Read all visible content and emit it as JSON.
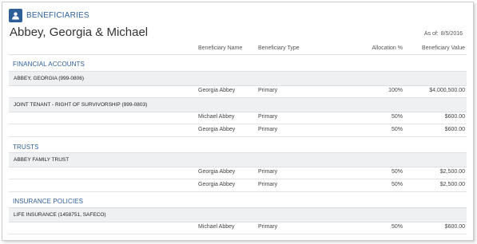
{
  "header": {
    "title": "BENEFICIARIES",
    "icon": "user-icon",
    "accent": "#2f5f98"
  },
  "client_name": "Abbey, Georgia & Michael",
  "as_of": {
    "label": "As of:",
    "date": "8/5/2016"
  },
  "columns": {
    "name": "Beneficiary Name",
    "type": "Beneficiary Type",
    "allocation": "Allocation %",
    "value": "Beneficiary Value"
  },
  "sections": [
    {
      "title": "FINANCIAL ACCOUNTS",
      "accounts": [
        {
          "name": "ABBEY, GEORGIA (999-0806)",
          "rows": [
            {
              "name": "Georgia Abbey",
              "type": "Primary",
              "allocation": "100%",
              "value": "$4,000,500.00"
            }
          ]
        },
        {
          "name": "JOINT TENANT - RIGHT OF SURVIVORSHIP (999-0803)",
          "rows": [
            {
              "name": "Michael Abbey",
              "type": "Primary",
              "allocation": "50%",
              "value": "$600.00"
            },
            {
              "name": "Georgia Abbey",
              "type": "Primary",
              "allocation": "50%",
              "value": "$600.00"
            }
          ]
        }
      ]
    },
    {
      "title": "TRUSTS",
      "accounts": [
        {
          "name": "ABBEY FAMILY TRUST",
          "rows": [
            {
              "name": "Georgia Abbey",
              "type": "Primary",
              "allocation": "50%",
              "value": "$2,500.00"
            },
            {
              "name": "Georgia Abbey",
              "type": "Primary",
              "allocation": "50%",
              "value": "$2,500.00"
            }
          ]
        }
      ]
    },
    {
      "title": "INSURANCE POLICIES",
      "accounts": [
        {
          "name": "LIFE INSURANCE (1458751, SAFECO)",
          "rows": [
            {
              "name": "Michael Abbey",
              "type": "Primary",
              "allocation": "50%",
              "value": "$600.00"
            }
          ]
        }
      ]
    }
  ]
}
